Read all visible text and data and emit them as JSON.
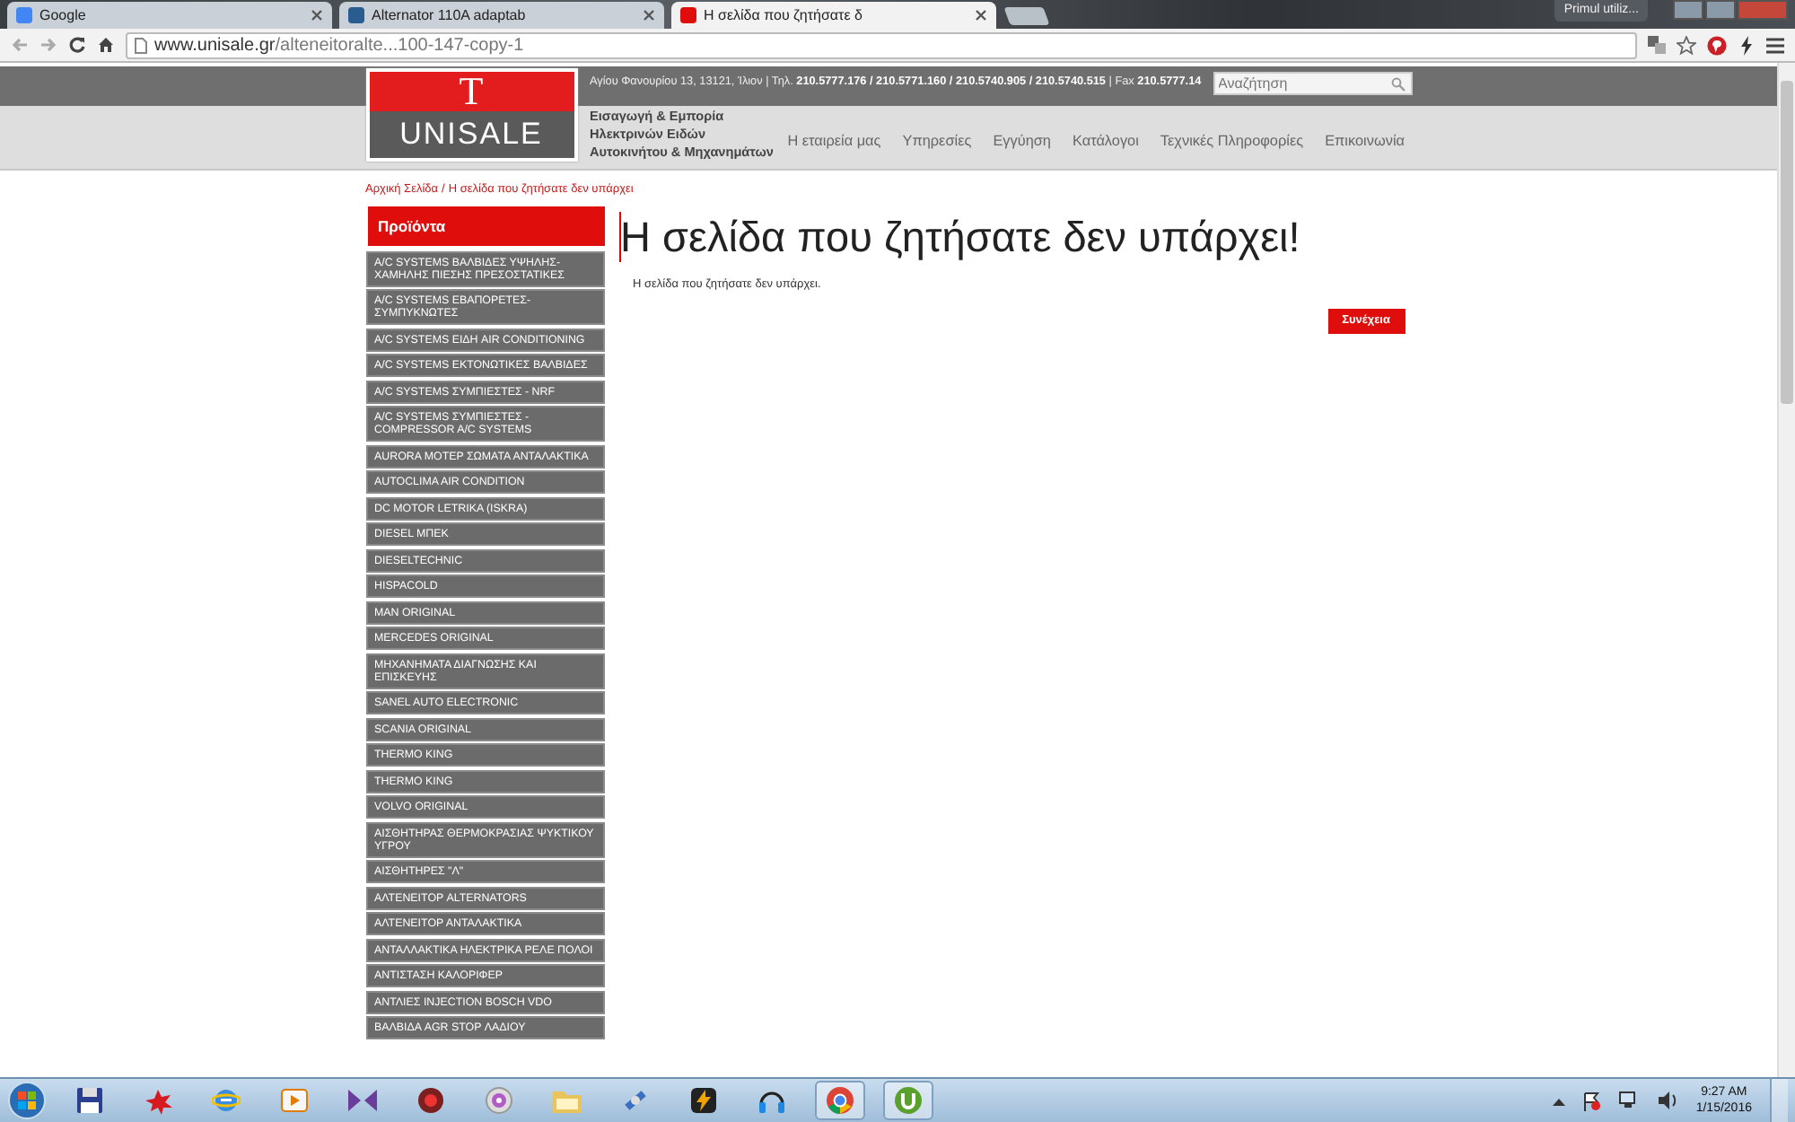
{
  "browser": {
    "tabs": [
      {
        "title": "Google",
        "selected": false
      },
      {
        "title": "Alternator 110A adaptab",
        "selected": false
      },
      {
        "title": "Η σελίδα που ζητήσατε δ",
        "selected": true
      }
    ],
    "profile": "Primul utiliz...",
    "url": "www.unisale.gr/alteneitoralte...100-147-copy-1"
  },
  "header": {
    "logo_letter": "T",
    "logo_name": "UNISALE",
    "contact": "Αγίου Φανουρίου 13, 13121, Ίλιον | Τηλ. **210.5777.176 / 210.5771.160 / 210.5740.905 / 210.5740.515** | Fax **210.5777.14**",
    "search": {
      "placeholder": "Αναζήτηση"
    },
    "tagline": [
      "Εισαγωγή & Εμπορία",
      "Ηλεκτρινών Ειδών",
      "Αυτοκινήτου & Μηχανημάτων"
    ],
    "nav": [
      "Η εταιρεία μας",
      "Υπηρεσίες",
      "Εγγύηση",
      "Κατάλογοι",
      "Τεχνικές Πληροφορίες",
      "Επικοινωνία"
    ]
  },
  "breadcrumb": {
    "separator": "/",
    "items": [
      "Αρχική Σελίδα",
      "Η σελίδα που ζητήσατε δεν υπάρχει"
    ]
  },
  "sidebar": {
    "title": "Προϊόντα",
    "items": [
      "A/C SYSTEMS ΒΑΛΒΙΔΕΣ ΥΨΗΛΗΣ-ΧΑΜΗΛΗΣ ΠΙΕΣΗΣ ΠΡΕΣΟΣΤΑΤΙΚΕΣ",
      "A/C SYSTEMS ΕΒΑΠΟΡΕΤΕΣ-ΣΥΜΠΥΚΝΩΤΕΣ",
      "A/C SYSTEMS ΕΙΔΗ AIR CONDITIONING",
      "A/C SYSTEMS ΕΚΤΟΝΩΤΙΚΕΣ ΒΑΛΒΙΔΕΣ",
      "A/C SYSTEMS ΣΥΜΠΙΕΣΤΕΣ - NRF",
      "A/C SYSTEMS ΣΥΜΠΙΕΣΤΕΣ - COMPRESSOR A/C SYSTEMS",
      "AURORA ΜΟΤΕΡ ΣΩΜΑΤΑ ΑΝΤΑΛΑΚΤΙΚΑ",
      "AUTOCLIMA AIR CONDITION",
      "DC MOTOR LETRIKA (ISKRA)",
      "DIESEL ΜΠΕΚ",
      "DIESELTECHNIC",
      "HISPACOLD",
      "MAN ORIGINAL",
      "MERCEDES ORIGINAL",
      "ΜΗΧΑΝΗΜΑΤΑ ΔΙΑΓΝΩΣΗΣ ΚΑΙ ΕΠΙΣΚΕΥΗΣ",
      "SANEL AUTO ELECTRONIC",
      "SCANIA ORIGINAL",
      "THERMO KING",
      "THERMO KING",
      "VOLVO ORIGINAL",
      "ΑΙΣΘΗΤΗΡΑΣ ΘΕΡΜΟΚΡΑΣΙΑΣ ΨΥΚΤΙΚΟΥ ΥΓΡΟΥ",
      "ΑΙΣΘΗΤΗΡΕΣ \"Λ\"",
      "ΑΛΤΕΝΕΙΤΟΡ ALTERNATORS",
      "ΑΛΤΕΝΕΙΤΟΡ ΑΝΤΑΛΑΚΤΙΚΑ",
      "ΑΝΤΑΛΛΑΚΤΙΚΑ ΗΛΕΚΤΡΙΚΑ ΡΕΛΕ ΠΟΛΟΙ",
      "ΑΝΤΙΣΤΑΣΗ ΚΑΛΟΡΙΦΕΡ",
      "ΑΝΤΛΙΕΣ INJECTION BOSCH VDO",
      "ΒΑΛΒΙΔΑ AGR STOP ΛΑΔΙΟΥ"
    ]
  },
  "main": {
    "title": "Η σελίδα που ζητήσατε δεν υπάρχει!",
    "message": "Η σελίδα που ζητήσατε δεν υπάρχει.",
    "button": "Συνέχεια"
  },
  "taskbar": {
    "time": "9:27 AM",
    "date": "1/15/2016"
  }
}
